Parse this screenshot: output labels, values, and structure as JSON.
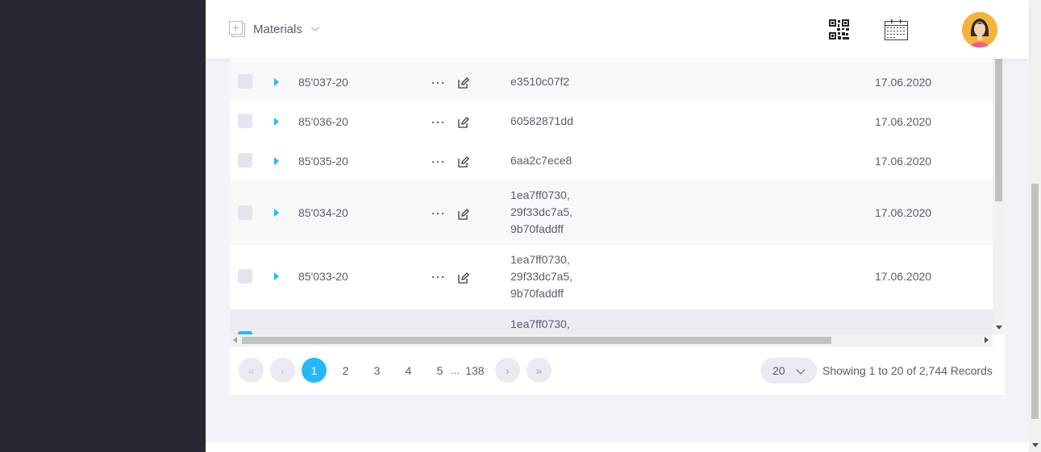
{
  "header": {
    "module_label": "Materials",
    "icons": [
      "module-icon",
      "chevron-down-icon",
      "qr-code-icon",
      "calendar-icon",
      "user-avatar"
    ]
  },
  "table": {
    "rows": [
      {
        "id": "85'037-20",
        "hashes": [
          "e3510c07f2"
        ],
        "date": "17.06.2020"
      },
      {
        "id": "85'036-20",
        "hashes": [
          "60582871dd"
        ],
        "date": "17.06.2020"
      },
      {
        "id": "85'035-20",
        "hashes": [
          "6aa2c7ece8"
        ],
        "date": "17.06.2020"
      },
      {
        "id": "85'034-20",
        "hashes": [
          "1ea7ff0730,",
          "29f33dc7a5,",
          "9b70faddff"
        ],
        "date": "17.06.2020"
      },
      {
        "id": "85'033-20",
        "hashes": [
          "1ea7ff0730,",
          "29f33dc7a5,",
          "9b70faddff"
        ],
        "date": "17.06.2020"
      },
      {
        "id": "",
        "hashes": [
          "1ea7ff0730,"
        ],
        "date": ""
      }
    ]
  },
  "pagination": {
    "first": "«",
    "prev": "‹",
    "pages": [
      "1",
      "2",
      "3",
      "4",
      "5"
    ],
    "ellipsis": "...",
    "last_page": "138",
    "next": "›",
    "last": "»",
    "active_page": "1",
    "page_size": "20",
    "records_text": "Showing 1 to 20 of 2,744 Records"
  },
  "colors": {
    "accent": "#22b9ff",
    "sidebar": "#282733",
    "text": "#595d6e"
  }
}
